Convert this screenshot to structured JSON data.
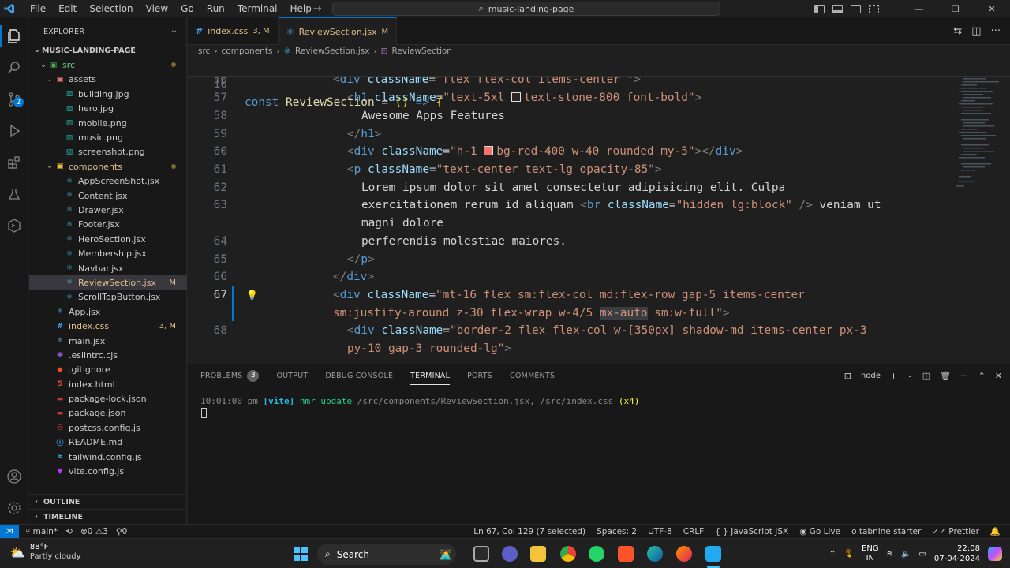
{
  "titlebar": {
    "menu": [
      "File",
      "Edit",
      "Selection",
      "View",
      "Go",
      "Run",
      "Terminal",
      "Help"
    ],
    "search": "music-landing-page"
  },
  "activity": {
    "scm_badge": "2"
  },
  "explorer": {
    "title": "EXPLORER",
    "root": "MUSIC-LANDING-PAGE",
    "items": [
      {
        "label": "src",
        "type": "folder"
      },
      {
        "label": "assets",
        "type": "folder"
      },
      {
        "label": "building.jpg",
        "type": "image"
      },
      {
        "label": "hero.jpg",
        "type": "image"
      },
      {
        "label": "mobile.png",
        "type": "image"
      },
      {
        "label": "music.png",
        "type": "image"
      },
      {
        "label": "screenshot.png",
        "type": "image"
      },
      {
        "label": "components",
        "type": "folder"
      },
      {
        "label": "AppScreenShot.jsx",
        "type": "react"
      },
      {
        "label": "Content.jsx",
        "type": "react"
      },
      {
        "label": "Drawer.jsx",
        "type": "react"
      },
      {
        "label": "Footer.jsx",
        "type": "react"
      },
      {
        "label": "HeroSection.jsx",
        "type": "react"
      },
      {
        "label": "Membership.jsx",
        "type": "react"
      },
      {
        "label": "Navbar.jsx",
        "type": "react"
      },
      {
        "label": "ReviewSection.jsx",
        "type": "react",
        "status": "M"
      },
      {
        "label": "ScrollTopButton.jsx",
        "type": "react"
      },
      {
        "label": "App.jsx",
        "type": "react"
      },
      {
        "label": "index.css",
        "type": "css",
        "status": "3, M"
      },
      {
        "label": "main.jsx",
        "type": "react"
      },
      {
        "label": ".eslintrc.cjs",
        "type": "eslint"
      },
      {
        "label": ".gitignore",
        "type": "git"
      },
      {
        "label": "index.html",
        "type": "html"
      },
      {
        "label": "package-lock.json",
        "type": "npm"
      },
      {
        "label": "package.json",
        "type": "npm"
      },
      {
        "label": "postcss.config.js",
        "type": "postcss"
      },
      {
        "label": "README.md",
        "type": "md"
      },
      {
        "label": "tailwind.config.js",
        "type": "tailwind"
      },
      {
        "label": "vite.config.js",
        "type": "vite"
      }
    ],
    "outline": "OUTLINE",
    "timeline": "TIMELINE"
  },
  "tabs": [
    {
      "label": "index.css",
      "status": "3, M",
      "active": false
    },
    {
      "label": "ReviewSection.jsx",
      "status": "M",
      "active": true
    }
  ],
  "breadcrumb": [
    "src",
    "components",
    "ReviewSection.jsx",
    "ReviewSection"
  ],
  "editor": {
    "sticky_line": {
      "num": "10",
      "text": "const ReviewSection = () => {"
    },
    "lines": [
      {
        "num": "56",
        "text": "<div className=\"flex flex-col items-center \">"
      },
      {
        "num": "57",
        "text": "<h1 className=\"text-5xl text-stone-800 font-bold\">"
      },
      {
        "num": "58",
        "text": "Awesome Apps Features"
      },
      {
        "num": "59",
        "text": "</h1>"
      },
      {
        "num": "60",
        "text": "<div className=\"h-1 bg-red-400 w-40 rounded my-5\"></div>"
      },
      {
        "num": "61",
        "text": "<p className=\"text-center text-lg opacity-85\">"
      },
      {
        "num": "62",
        "text": "Lorem ipsum dolor sit amet consectetur adipisicing elit. Culpa"
      },
      {
        "num": "63",
        "text": "exercitationem rerum id aliquam <br className=\"hidden lg:block\" /> veniam ut"
      },
      {
        "num": "",
        "text": "magni dolore"
      },
      {
        "num": "64",
        "text": "perferendis molestiae maiores."
      },
      {
        "num": "65",
        "text": "</p>"
      },
      {
        "num": "66",
        "text": "</div>"
      },
      {
        "num": "67",
        "text": "<div className=\"mt-16 flex sm:flex-col md:flex-row gap-5 items-center"
      },
      {
        "num": "",
        "text": "sm:justify-around z-30 flex-wrap w-4/5 mx-auto sm:w-full\">"
      },
      {
        "num": "68",
        "text": "<div className=\"border-2 flex flex-col w-[350px] shadow-md items-center px-3"
      },
      {
        "num": "",
        "text": "py-10 gap-3 rounded-lg\">"
      }
    ]
  },
  "panel": {
    "tabs": [
      "PROBLEMS",
      "OUTPUT",
      "DEBUG CONSOLE",
      "TERMINAL",
      "PORTS",
      "COMMENTS"
    ],
    "problems_count": "3",
    "terminal_name": "node",
    "log": {
      "time": "10:01:00 pm",
      "tag": "[vite]",
      "action": "hmr update",
      "paths": "/src/components/ReviewSection.jsx, /src/index.css",
      "count": "(x4)"
    }
  },
  "statusbar": {
    "branch": "main*",
    "errors": "0",
    "warnings": "3",
    "ports": "0",
    "position": "Ln 67, Col 129 (7 selected)",
    "spaces": "Spaces: 2",
    "encoding": "UTF-8",
    "eol": "CRLF",
    "language": "JavaScript JSX",
    "golive": "Go Live",
    "tabnine": "tabnine starter",
    "prettier": "Prettier"
  },
  "taskbar": {
    "temp": "88°F",
    "weather": "Partly cloudy",
    "search": "Search",
    "lang1": "ENG",
    "lang2": "IN",
    "time": "22:08",
    "date": "07-04-2024"
  },
  "colors": {
    "accent": "#0078d4",
    "stone800": "#292524",
    "red400": "#f87171"
  }
}
